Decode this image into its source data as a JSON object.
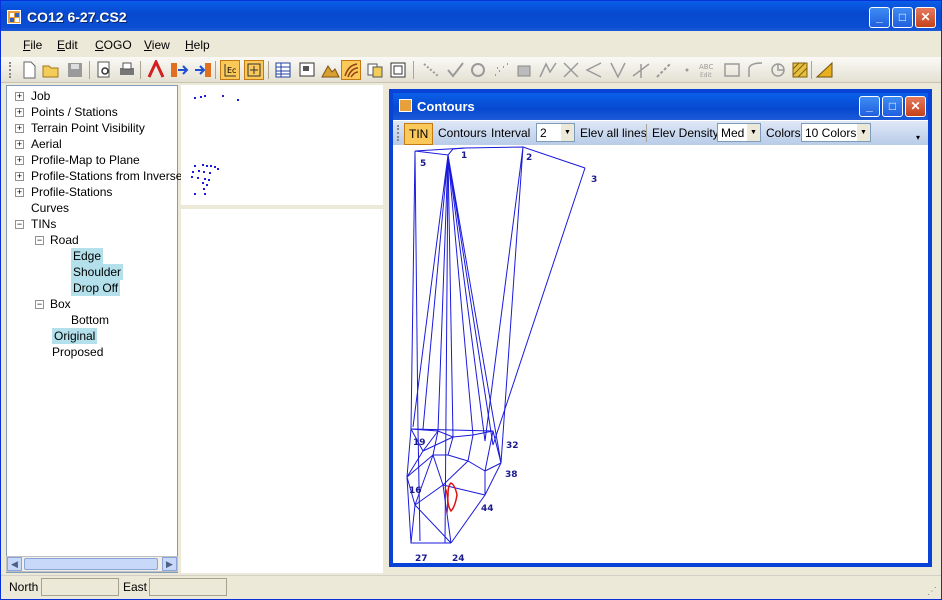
{
  "window": {
    "title": "CO12 6-27.CS2",
    "min": "_",
    "max": "□",
    "close": "✕"
  },
  "menu": [
    {
      "label": "File",
      "u": "F",
      "rest": "ile"
    },
    {
      "label": "Edit",
      "u": "E",
      "rest": "dit"
    },
    {
      "label": "COGO",
      "u": "C",
      "rest": "OGO"
    },
    {
      "label": "View",
      "u": "V",
      "rest": "iew"
    },
    {
      "label": "Help",
      "u": "H",
      "rest": "elp"
    }
  ],
  "tree": {
    "items": [
      {
        "label": "Job",
        "expander": "+"
      },
      {
        "label": "Points / Stations",
        "expander": "+"
      },
      {
        "label": "Terrain Point Visibility",
        "expander": "+"
      },
      {
        "label": "Aerial",
        "expander": "+"
      },
      {
        "label": "Profile-Map to Plane",
        "expander": "+"
      },
      {
        "label": "Profile-Stations from Inverse",
        "expander": "+"
      },
      {
        "label": "Profile-Stations",
        "expander": "+"
      },
      {
        "label": "Curves",
        "expander": ""
      },
      {
        "label": "TINs",
        "expander": "−"
      },
      {
        "label": "Road",
        "expander": "−"
      },
      {
        "label": "Edge",
        "expander": ""
      },
      {
        "label": "Shoulder",
        "expander": ""
      },
      {
        "label": "Drop Off",
        "expander": ""
      },
      {
        "label": "Box",
        "expander": "−"
      },
      {
        "label": "Bottom",
        "expander": ""
      },
      {
        "label": "Original",
        "expander": ""
      },
      {
        "label": "Proposed",
        "expander": ""
      }
    ]
  },
  "contours": {
    "title": "Contours",
    "tin_label": "TIN",
    "contours_label": "Contours",
    "interval_label": "Interval",
    "interval_value": "2",
    "elev_all_lines_label": "Elev all lines",
    "elev_density_label": "Elev Density",
    "elev_density_value": "Med",
    "colors_label": "Colors",
    "colors_value": "10 Colors",
    "point_labels": [
      "5",
      "1",
      "2",
      "3",
      "19",
      "32",
      "38",
      "16",
      "44",
      "27",
      "24"
    ]
  },
  "status": {
    "north_label": "North",
    "east_label": "East"
  },
  "colors": {
    "title_blue": "#0a4ed2",
    "selection": "#b3e0ea",
    "tin_lines": "#1a1adc",
    "contour_red": "#e01010"
  },
  "icons": [
    "new-icon",
    "open-icon",
    "save-icon",
    "print-preview-icon",
    "print-icon",
    "text-style-icon",
    "import-icon",
    "export-icon",
    "coordinates-icon",
    "zoom-extents-icon",
    "table-icon",
    "window-icon",
    "terrain-icon",
    "contours-icon",
    "copy-icon",
    "layers-icon",
    "line-icon",
    "check-icon",
    "circle-icon",
    "points-icon",
    "grid-icon",
    "polyline-icon",
    "intersect-icon",
    "angle-icon",
    "bearing-icon",
    "traverse-icon",
    "measure-icon",
    "dot-icon",
    "abc-edit-icon",
    "image-icon",
    "curve-icon",
    "arc-icon",
    "hatch-icon",
    "ruler-icon"
  ]
}
